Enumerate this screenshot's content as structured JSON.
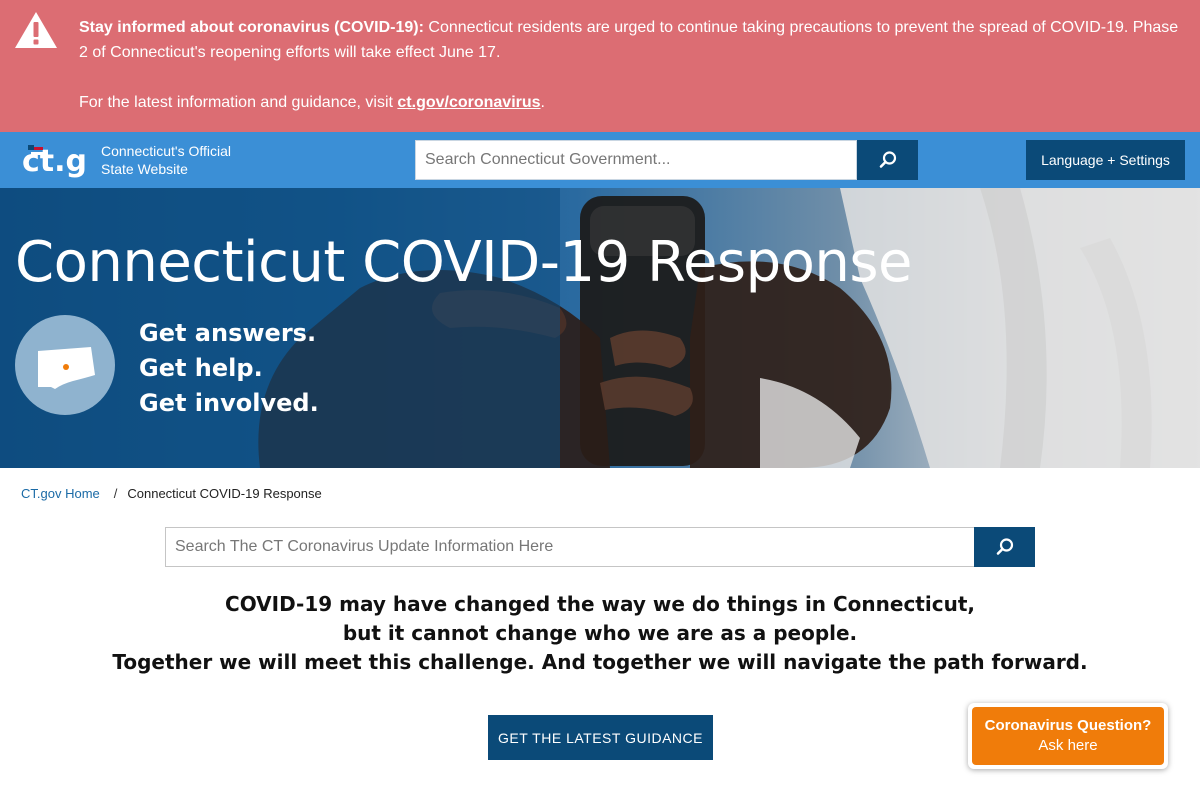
{
  "alert": {
    "icon": "warning-triangle-icon",
    "heading": "Stay informed about coronavirus (COVID-19):",
    "body": " Connecticut residents are urged to continue taking precautions to prevent the spread of COVID-19. Phase 2 of Connecticut's reopening efforts will take effect June 17.",
    "info_prefix": "For the latest information and guidance, visit ",
    "link_text": "ct.gov/coronavirus",
    "info_suffix": ".",
    "color": "#dc6d73"
  },
  "header": {
    "logo_text": "ct.gov",
    "logo_line1": "Connecticut's Official",
    "logo_line2": "State Website",
    "search_placeholder": "Search Connecticut Government...",
    "search_icon": "search-icon",
    "language_button": "Language + Settings",
    "color": "#3b8fd6"
  },
  "hero": {
    "title": "Connecticut COVID-19 Response",
    "lines": [
      "Get answers.",
      "Get help.",
      "Get involved."
    ],
    "icon": "connecticut-map-icon"
  },
  "breadcrumb": {
    "home": "CT.gov Home",
    "separator": "/",
    "current": "Connecticut COVID-19 Response"
  },
  "main": {
    "search_placeholder": "Search The CT Coronavirus Update Information Here",
    "message": [
      "COVID-19 may have changed the way we do things in Connecticut,",
      "but it cannot change who we are as a people.",
      "Together we will meet this challenge. And together we will navigate the path forward."
    ],
    "cta": "GET THE LATEST GUIDANCE",
    "accent": "#0b4a78"
  },
  "chat": {
    "title": "Coronavirus Question?",
    "subtitle": "Ask here",
    "color": "#f07c0a"
  }
}
